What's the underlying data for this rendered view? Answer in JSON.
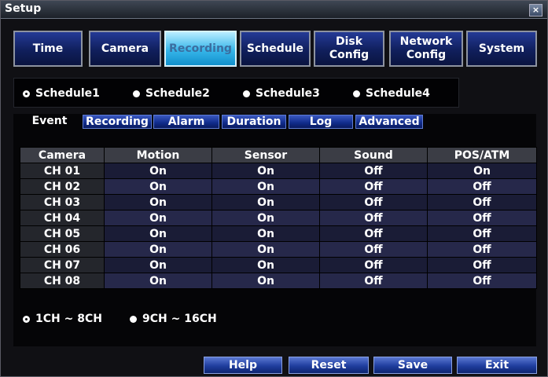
{
  "window": {
    "title": "Setup",
    "close_glyph": "×"
  },
  "main_tabs": [
    "Time",
    "Camera",
    "Recording",
    "Schedule",
    "Disk\nConfig",
    "Network\nConfig",
    "System"
  ],
  "active_main_tab": "Recording",
  "schedules": [
    "Schedule1",
    "Schedule2",
    "Schedule3",
    "Schedule4"
  ],
  "selected_schedule": "Schedule1",
  "sub_tabs": [
    "Event",
    "Recording",
    "Alarm",
    "Duration",
    "Log",
    "Advanced"
  ],
  "active_sub_tab": "Event",
  "table": {
    "headers": [
      "Camera",
      "Motion",
      "Sensor",
      "Sound",
      "POS/ATM"
    ],
    "rows": [
      [
        "CH 01",
        "On",
        "On",
        "Off",
        "On"
      ],
      [
        "CH 02",
        "On",
        "On",
        "Off",
        "Off"
      ],
      [
        "CH 03",
        "On",
        "On",
        "Off",
        "Off"
      ],
      [
        "CH 04",
        "On",
        "On",
        "Off",
        "Off"
      ],
      [
        "CH 05",
        "On",
        "On",
        "Off",
        "Off"
      ],
      [
        "CH 06",
        "On",
        "On",
        "Off",
        "Off"
      ],
      [
        "CH 07",
        "On",
        "On",
        "Off",
        "Off"
      ],
      [
        "CH 08",
        "On",
        "On",
        "Off",
        "Off"
      ]
    ]
  },
  "channel_ranges": [
    "1CH ~ 8CH",
    "9CH ~ 16CH"
  ],
  "selected_range": "1CH ~ 8CH",
  "buttons": {
    "help": "Help",
    "reset": "Reset",
    "save": "Save",
    "exit": "Exit"
  },
  "colors": {
    "active_tab": "#36b6ea",
    "tab": "#101f5c",
    "row_dark": "#1a1c36",
    "row_light": "#26284a"
  }
}
